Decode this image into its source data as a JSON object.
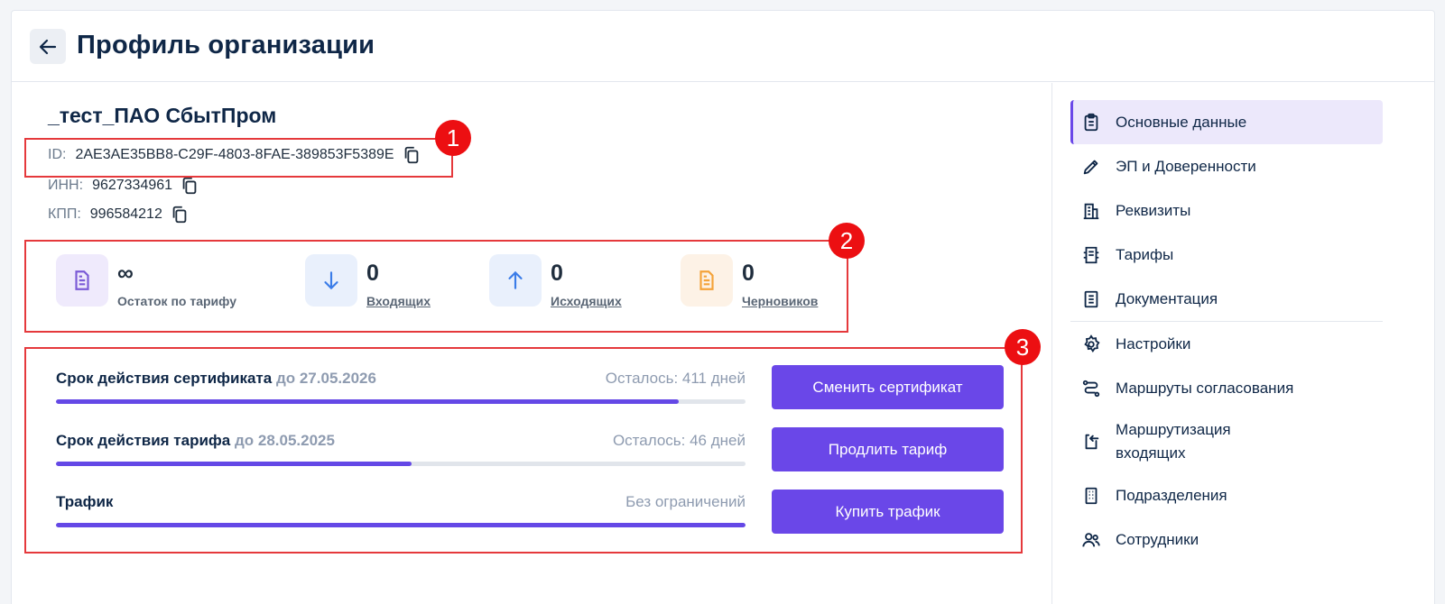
{
  "header": {
    "title": "Профиль организации"
  },
  "org": {
    "name": "_тест_ПАО СбытПром",
    "id_label": "ID:",
    "id_value": "2AE3AE35BB8-C29F-4803-8FAE-389853F5389E",
    "inn_label": "ИНН:",
    "inn_value": "9627334961",
    "kpp_label": "КПП:",
    "kpp_value": "996584212"
  },
  "annotations": [
    "1",
    "2",
    "3"
  ],
  "stats": [
    {
      "value": "∞",
      "label": "Остаток по тарифу",
      "icon": "document-icon",
      "color": "#7b5bd6"
    },
    {
      "value": "0",
      "label": "Входящих",
      "icon": "arrow-down-icon",
      "color": "#3a7ce8"
    },
    {
      "value": "0",
      "label": "Исходящих",
      "icon": "arrow-up-icon",
      "color": "#3a7ce8"
    },
    {
      "value": "0",
      "label": "Черновиков",
      "icon": "draft-document-icon",
      "color": "#f4a33a"
    }
  ],
  "limits": [
    {
      "title": "Срок действия сертификата",
      "date": "до 27.05.2026",
      "remaining": "Осталось: 411 дней",
      "progress": 0.903,
      "button": "Сменить сертификат"
    },
    {
      "title": "Срок действия тарифа",
      "date": "до 28.05.2025",
      "remaining": "Осталось: 46 дней",
      "progress": 0.516,
      "button": "Продлить тариф"
    },
    {
      "title": "Трафик",
      "date": "",
      "remaining": "Без ограничений",
      "progress": 1.0,
      "button": "Купить трафик"
    }
  ],
  "sidebar": {
    "items": [
      {
        "label": "Основные данные",
        "icon": "clipboard-icon",
        "active": true
      },
      {
        "label": "ЭП и Доверенности",
        "icon": "pen-icon",
        "active": false
      },
      {
        "label": "Реквизиты",
        "icon": "building-icon",
        "active": false
      },
      {
        "label": "Тарифы",
        "icon": "tariff-icon",
        "active": false
      },
      {
        "label": "Документация",
        "icon": "doc-list-icon",
        "active": false
      },
      {
        "label": "Настройки",
        "icon": "gear-icon",
        "active": false
      },
      {
        "label": "Маршруты согласования",
        "icon": "route-icon",
        "active": false
      },
      {
        "label": "Маршрутизация входящих",
        "icon": "incoming-routing-icon",
        "active": false
      },
      {
        "label": "Подразделения",
        "icon": "departments-icon",
        "active": false
      },
      {
        "label": "Сотрудники",
        "icon": "employees-icon",
        "active": false
      }
    ]
  },
  "colors": {
    "accent": "#6a47e8",
    "annotation": "#e5393c",
    "title": "#0f2747"
  }
}
